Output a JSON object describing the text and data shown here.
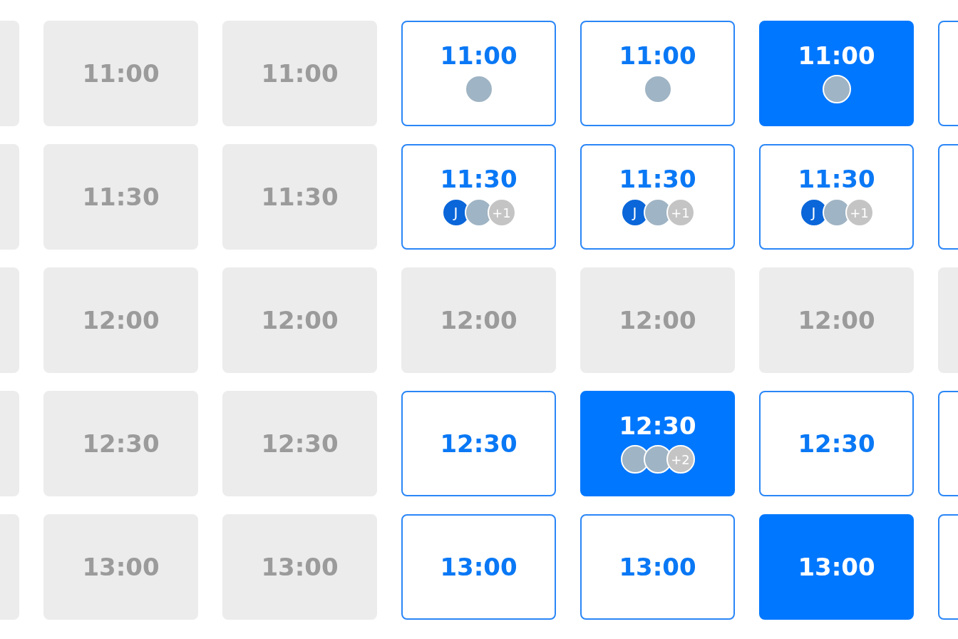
{
  "columns": [
    {
      "slots": [
        {
          "disabled": true,
          "selected": false
        },
        {
          "disabled": true,
          "selected": false
        },
        {
          "disabled": true,
          "selected": false
        },
        {
          "disabled": true,
          "selected": false
        },
        {
          "disabled": true,
          "selected": false
        }
      ]
    },
    {
      "slots": [
        {
          "disabled": true,
          "selected": false,
          "time": "11:00"
        },
        {
          "disabled": true,
          "selected": false,
          "time": "11:30"
        },
        {
          "disabled": true,
          "selected": false,
          "time": "12:00"
        },
        {
          "disabled": true,
          "selected": false,
          "time": "12:30"
        },
        {
          "disabled": true,
          "selected": false,
          "time": "13:00"
        }
      ]
    },
    {
      "slots": [
        {
          "disabled": true,
          "selected": false,
          "time": "11:00"
        },
        {
          "disabled": true,
          "selected": false,
          "time": "11:30"
        },
        {
          "disabled": true,
          "selected": false,
          "time": "12:00"
        },
        {
          "disabled": true,
          "selected": false,
          "time": "12:30"
        },
        {
          "disabled": true,
          "selected": false,
          "time": "13:00"
        }
      ]
    },
    {
      "slots": [
        {
          "disabled": false,
          "selected": false,
          "time": "11:00",
          "attendees": [
            {
              "kind": "photo"
            }
          ]
        },
        {
          "disabled": false,
          "selected": false,
          "time": "11:30",
          "attendees": [
            {
              "kind": "initial",
              "text": "J"
            },
            {
              "kind": "photo"
            },
            {
              "kind": "more",
              "text": "+1"
            }
          ]
        },
        {
          "disabled": true,
          "selected": false,
          "time": "12:00"
        },
        {
          "disabled": false,
          "selected": false,
          "time": "12:30"
        },
        {
          "disabled": false,
          "selected": false,
          "time": "13:00"
        }
      ]
    },
    {
      "slots": [
        {
          "disabled": false,
          "selected": false,
          "time": "11:00",
          "attendees": [
            {
              "kind": "photo"
            }
          ]
        },
        {
          "disabled": false,
          "selected": false,
          "time": "11:30",
          "attendees": [
            {
              "kind": "initial",
              "text": "J"
            },
            {
              "kind": "photo"
            },
            {
              "kind": "more",
              "text": "+1"
            }
          ]
        },
        {
          "disabled": true,
          "selected": false,
          "time": "12:00"
        },
        {
          "disabled": false,
          "selected": true,
          "time": "12:30",
          "attendees": [
            {
              "kind": "photo"
            },
            {
              "kind": "photo"
            },
            {
              "kind": "more",
              "text": "+2"
            }
          ]
        },
        {
          "disabled": false,
          "selected": false,
          "time": "13:00"
        }
      ]
    },
    {
      "slots": [
        {
          "disabled": false,
          "selected": true,
          "time": "11:00",
          "attendees": [
            {
              "kind": "photo"
            }
          ]
        },
        {
          "disabled": false,
          "selected": false,
          "time": "11:30",
          "attendees": [
            {
              "kind": "initial",
              "text": "J"
            },
            {
              "kind": "photo"
            },
            {
              "kind": "more",
              "text": "+1"
            }
          ]
        },
        {
          "disabled": true,
          "selected": false,
          "time": "12:00"
        },
        {
          "disabled": false,
          "selected": false,
          "time": "12:30"
        },
        {
          "disabled": false,
          "selected": true,
          "time": "13:00"
        }
      ]
    },
    {
      "slots": [
        {
          "disabled": false,
          "selected": false
        },
        {
          "disabled": false,
          "selected": false
        },
        {
          "disabled": true,
          "selected": false
        },
        {
          "disabled": false,
          "selected": false
        },
        {
          "disabled": false,
          "selected": false
        }
      ]
    }
  ]
}
